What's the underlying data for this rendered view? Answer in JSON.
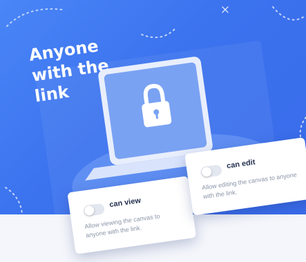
{
  "headline": "Anyone\nwith the\nlink",
  "icons": [
    "padlock-icon",
    "laptop-illustration"
  ],
  "colors": {
    "background": "#3b72ee",
    "card": "#ffffff",
    "toggle_off": "#e3e7f0",
    "title_text": "#23304f",
    "description_text": "#8a94a8"
  },
  "options": {
    "view": {
      "title": "can view",
      "description": "Allow viewing the canvas to anyone with the link.",
      "enabled": false
    },
    "edit": {
      "title": "can edit",
      "description": "Allow editing the canvas to anyone with the link.",
      "enabled": false
    }
  }
}
